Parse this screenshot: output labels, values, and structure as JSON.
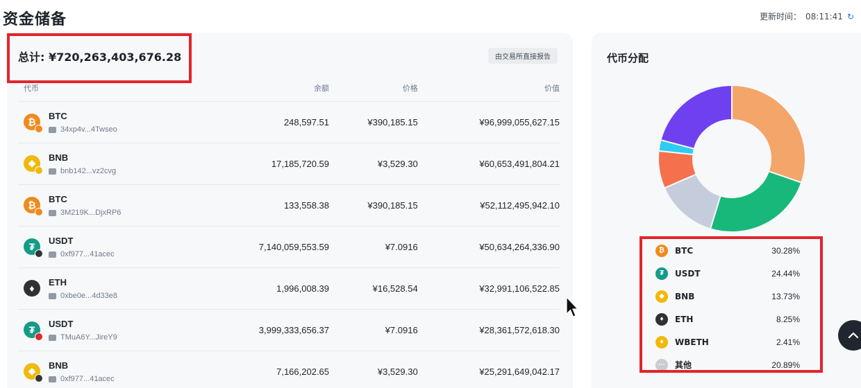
{
  "header": {
    "title": "资金储备",
    "update_label": "更新时间：",
    "update_time": "08:11:41"
  },
  "reserves": {
    "total": "总计: ¥720,263,403,676.28",
    "report_tag": "由交易所直接报告",
    "columns": {
      "token": "代币",
      "balance": "余额",
      "price": "价格",
      "value": "价值"
    },
    "rows": [
      {
        "symbol": "BTC",
        "address": "34xp4v...4Twseo",
        "balance": "248,597.51",
        "price": "¥390,185.15",
        "value": "¥96,999,055,627.15",
        "icon": "bitcoin-icon",
        "color": "#f08a1c",
        "glyph": "₿",
        "chain_color": "#f08a1c"
      },
      {
        "symbol": "BNB",
        "address": "bnb142...vz2cvg",
        "balance": "17,185,720.59",
        "price": "¥3,529.30",
        "value": "¥60,653,491,804.21",
        "icon": "bnb-icon",
        "color": "#f0b90b",
        "glyph": "◆",
        "chain_color": "#f0b90b"
      },
      {
        "symbol": "BTC",
        "address": "3M219K...DjxRP6",
        "balance": "133,558.38",
        "price": "¥390,185.15",
        "value": "¥52,112,495,942.10",
        "icon": "bitcoin-icon",
        "color": "#f08a1c",
        "glyph": "₿",
        "chain_color": "#f08a1c"
      },
      {
        "symbol": "USDT",
        "address": "0xf977...41acec",
        "balance": "7,140,059,553.59",
        "price": "¥7.0916",
        "value": "¥50,634,264,336.90",
        "icon": "tether-icon",
        "color": "#149b87",
        "glyph": "₮",
        "chain_color": "#343434"
      },
      {
        "symbol": "ETH",
        "address": "0xbe0e...4d33e8",
        "balance": "1,996,008.39",
        "price": "¥16,528.54",
        "value": "¥32,991,106,522.85",
        "icon": "ethereum-icon",
        "color": "#2f3137",
        "glyph": "♦",
        "chain_color": ""
      },
      {
        "symbol": "USDT",
        "address": "TMuA6Y...JireY9",
        "balance": "3,999,333,656.37",
        "price": "¥7.0916",
        "value": "¥28,361,572,618.30",
        "icon": "tether-icon",
        "color": "#149b87",
        "glyph": "₮",
        "chain_color": "#e0262a"
      },
      {
        "symbol": "BNB",
        "address": "0xf977...41acec",
        "balance": "7,166,202.65",
        "price": "¥3,529.30",
        "value": "¥25,291,649,042.17",
        "icon": "bnb-icon",
        "color": "#f0b90b",
        "glyph": "◆",
        "chain_color": "#343434"
      }
    ]
  },
  "distribution": {
    "title": "代币分配",
    "items": [
      {
        "name": "BTC",
        "pct": "30.28%",
        "value": 30.28,
        "slice_color": "#f3a56a",
        "icon": "bitcoin-icon",
        "icon_color": "#f08a1c",
        "glyph": "₿"
      },
      {
        "name": "USDT",
        "pct": "24.44%",
        "value": 24.44,
        "slice_color": "#18b87a",
        "icon": "tether-icon",
        "icon_color": "#149b87",
        "glyph": "₮"
      },
      {
        "name": "BNB",
        "pct": "13.73%",
        "value": 13.73,
        "slice_color": "#c5ccdc",
        "icon": "bnb-icon",
        "icon_color": "#f0b90b",
        "glyph": "◆"
      },
      {
        "name": "ETH",
        "pct": "8.25%",
        "value": 8.25,
        "slice_color": "#f5704d",
        "icon": "ethereum-icon",
        "icon_color": "#2f3137",
        "glyph": "♦"
      },
      {
        "name": "WBETH",
        "pct": "2.41%",
        "value": 2.41,
        "slice_color": "#2ccdf0",
        "icon": "wbeth-icon",
        "icon_color": "#f0b90b",
        "glyph": "♦"
      },
      {
        "name": "其他",
        "pct": "20.89%",
        "value": 20.89,
        "slice_color": "#6f40f0",
        "icon": "more-icon",
        "icon_color": "#c9ccd1",
        "glyph": "···"
      }
    ]
  }
}
